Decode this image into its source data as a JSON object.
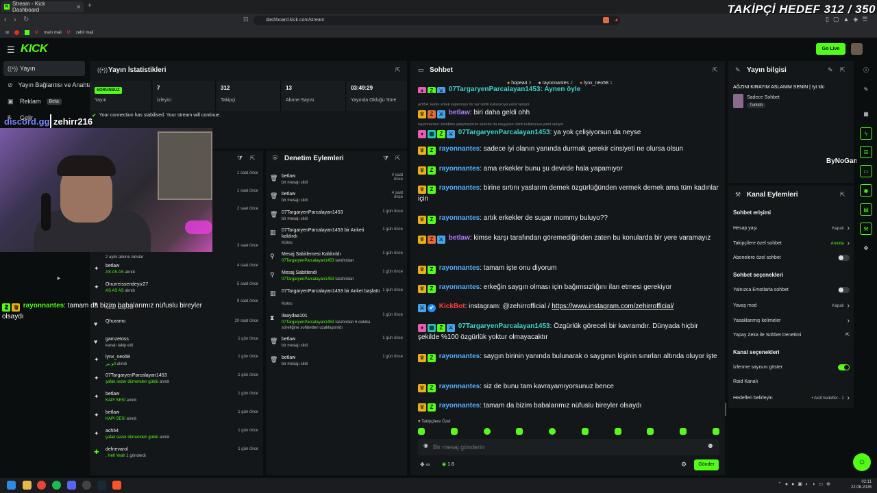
{
  "overlay": {
    "goal": "TAKİPÇİ HEDEF 312 / 350",
    "discord": "discord.gg",
    "streamer": "zehirr216",
    "watermark": "ByNoGame"
  },
  "browser": {
    "tab_title": "Stream - Kick Dashboard",
    "url": "dashboard.kick.com/stream",
    "bookmarks": [
      "main mail",
      "zehir mail"
    ]
  },
  "header": {
    "go_live": "Go Live"
  },
  "sidebar": {
    "items": [
      {
        "label": "Yayın",
        "icon": "broadcast-icon"
      },
      {
        "label": "Yayın Bağlantısı ve Anahtarı",
        "icon": "link-icon"
      },
      {
        "label": "Reklam",
        "icon": "ad-icon",
        "badge": "Beta"
      },
      {
        "label": "Gelir",
        "icon": "money-icon"
      }
    ]
  },
  "stats": {
    "title": "Yayın İstatistikleri",
    "status_badge": "SORUNSUZ",
    "items": [
      {
        "value": "",
        "label": "Yayın"
      },
      {
        "value": "7",
        "label": "İzleyici"
      },
      {
        "value": "312",
        "label": "Takipçi"
      },
      {
        "value": "13",
        "label": "Abone Sayısı"
      },
      {
        "value": "03:49:29",
        "label": "Yayında Olduğu Süre"
      }
    ],
    "notice": "Your connection has stabilised. Your stream will continue."
  },
  "activity": {
    "items": [
      {
        "name": "",
        "sub": "",
        "time": "1 saat önce"
      },
      {
        "name": "",
        "sub": "",
        "time": "1 saat önce"
      },
      {
        "name": "",
        "sub": "",
        "time": "2 saat önce"
      },
      {
        "name": "",
        "sub": "",
        "time": "3 saat önce"
      },
      {
        "name": "",
        "sub": "2 aylık abone oldular",
        "time": ""
      },
      {
        "name": "betlaw",
        "sub": "AS AS AS",
        "sub2": "alındı",
        "time": "4 saat önce"
      },
      {
        "name": "Onurreissendeyiz27",
        "sub": "AS AS AS",
        "sub2": "alındı",
        "time": "5 saat önce"
      },
      {
        "name": "",
        "sub": "kanalı takip etti",
        "time": "9 saat önce"
      },
      {
        "name": "Qhuramo",
        "sub": "",
        "time": "20 saat önce"
      },
      {
        "name": "gamzetoss",
        "sub": "kanalı takip etti",
        "time": "1 gün önce"
      },
      {
        "name": "lynx_neo58",
        "sub": "الو بير",
        "sub2": "alındı",
        "time": "1 gün önce"
      },
      {
        "name": "07TargaryenParcalayan1453",
        "sub": "şafak sezer dümenden güldü",
        "sub2": "alındı",
        "time": "1 gün önce"
      },
      {
        "name": "betlaw",
        "sub": "KAPI SESİ",
        "sub2": "alındı",
        "time": "1 gün önce"
      },
      {
        "name": "betlaw",
        "sub": "KAPI SESİ",
        "sub2": "alındı",
        "time": "1 gün önce"
      },
      {
        "name": "ach54",
        "sub": "şafak sezer dümenden güldü",
        "sub2": "alındı",
        "time": "1 gün önce"
      },
      {
        "name": "defnevarol",
        "sub": ", Hell Yeah",
        "sub2": "1",
        "sub3": "gönderdi",
        "time": "1 gün önce"
      }
    ]
  },
  "overlay_chat": {
    "user": "rayonnantes",
    "text": ": tamam da bizim babalarımız nüfuslu bireyler olsaydı"
  },
  "moderation": {
    "title": "Denetim Eylemleri",
    "items": [
      {
        "icon": "trash-icon",
        "name": "betlaw",
        "sub": "bir mesajı sildi",
        "time": "4 saat önce"
      },
      {
        "icon": "trash-icon",
        "name": "betlaw",
        "sub": "bir mesajı sildi",
        "time": "4 saat önce"
      },
      {
        "icon": "trash-icon",
        "name": "07TargaryenParcalayan1453",
        "sub": "bir mesajı sildi",
        "time": "1 gün önce"
      },
      {
        "icon": "poll-icon",
        "name": "07TargaryenParcalayan1453 bir Anketi kaldırdı",
        "sub": "Kokru",
        "time": "1 gün önce"
      },
      {
        "icon": "pin-icon",
        "name": "Mesaj Sabitlemesi Kaldırıldı",
        "sub": "07TargaryenParcalayan1453 tarafından",
        "time": "1 gün önce"
      },
      {
        "icon": "pin-icon",
        "name": "Mesaj Sabitlendi",
        "sub": "07TargaryenParcalayan1453 tarafından",
        "time": "1 gün önce"
      },
      {
        "icon": "poll-icon",
        "name": "07TargaryenParcalayan1453 bir Anket başlattı",
        "sub": "Kokru",
        "time": "1 gün önce"
      },
      {
        "icon": "timeout-icon",
        "name": "ilaaydaa101",
        "sub": "07TargaryenParcalayan1453 tarafından 5 dakika süreliğine sohbetten uzaklaştırıldı",
        "time": "1 gün önce"
      },
      {
        "icon": "trash-icon",
        "name": "betlaw",
        "sub": "bir mesajı sildi",
        "time": "1 gün önce"
      },
      {
        "icon": "trash-icon",
        "name": "betlaw",
        "sub": "bir mesajı sildi",
        "time": "1 gün önce"
      }
    ]
  },
  "chat": {
    "title": "Sohbet",
    "top_users": [
      {
        "name": "hopea4",
        "count": "3"
      },
      {
        "name": "rayonnantes",
        "count": "2"
      },
      {
        "name": "lynx_neo58",
        "count": "1"
      }
    ],
    "partial_top": "07TargaryenParcalayan1453: Aynen öyle",
    "reply1": "ach54: kadın erkek kapısması mı var isimli kullanıcıya yanıt veriyor",
    "reply2": "rayonnantes: kendime çalışmıyorum aslında da neyyysse isimli kullanıcıya yanıt veriyor",
    "messages": [
      {
        "user": "betlaw",
        "text": ": biri daha geldi ohh"
      },
      {
        "user": "07TargaryenParcalayan1453",
        "text": ": ya yok çelişiyorsun da neyse"
      },
      {
        "user": "rayonnantes",
        "text": ": sadece iyi olanın yanında durmak gerekir cinsiyeti ne olursa olsun"
      },
      {
        "user": "rayonnantes",
        "text": ": ama erkekler bunu şu devirde hala yapamıyor"
      },
      {
        "user": "rayonnantes",
        "text": ": birine sırtını yaslarım demek özgürlüğünden vermek demek ama tüm kadınlar için"
      },
      {
        "user": "rayonnantes",
        "text": ": artık erkekler de sugar mommy buluyo??"
      },
      {
        "user": "betlaw",
        "text": ": kimse karşı tarafından göremediğinden zaten bu konularda bir yere varamayız"
      },
      {
        "user": "rayonnantes",
        "text": ": tamam işte onu diyorum"
      },
      {
        "user": "rayonnantes",
        "text": ": erkeğin saygın olması için bağımsızlığını ilan etmesi gerekiyor"
      },
      {
        "user": "KickBot",
        "text": ": instagram: @zehirrofficial / ",
        "link": "https://www.instagram.com/zehirrofficial/"
      },
      {
        "user": "07TargaryenParcalayan1453",
        "text": ": Özgürlük göreceli bir kavramdır. Dünyada hiçbir şekilde %100 özgürlük yoktur olmayacaktır"
      },
      {
        "user": "rayonnantes",
        "text": ": saygın birinin yanında bulunarak o saygının kişinin sınırları altında oluyor işte"
      },
      {
        "user": "rayonnantes",
        "text": ": siz de bunu tam kavrayamıyorsunuz bence"
      },
      {
        "user": "rayonnantes",
        "text": ": tamam da bizim babalarımız nüfuslu bireyler olsaydı"
      }
    ],
    "followers_only": "Takipçilere Özel",
    "input_placeholder": "Bir mesaj gönderin",
    "viewer_count": "1 8",
    "send_label": "Gönder"
  },
  "stream_info": {
    "title": "Yayın bilgisi",
    "stream_title": "AĞZINI KIRAYIM ASLANIM SENİN | !yt !dc",
    "category": "Sadece Sohbet",
    "tag": "Turkish"
  },
  "channel_actions": {
    "title": "Kanal Eylemleri",
    "sections": [
      {
        "heading": "Sohbet erişimi",
        "rows": [
          {
            "label": "Hesap yaşı",
            "value": "Kapalı",
            "type": "chevron"
          },
          {
            "label": "Takipçilere özel sohbet",
            "value": "Anında",
            "type": "chevron",
            "accent": true
          },
          {
            "label": "Abonelere özel sohbet",
            "value": "",
            "type": "toggle-off"
          }
        ]
      },
      {
        "heading": "Sohbet seçenekleri",
        "rows": [
          {
            "label": "Yalnızca Emotlarla sohbet",
            "value": "",
            "type": "toggle-off"
          },
          {
            "label": "Yavaş mod",
            "value": "Kapalı",
            "type": "chevron"
          },
          {
            "label": "Yasaklanmış kelimeler",
            "value": "",
            "type": "chevron"
          },
          {
            "label": "Yapay Zeka ile Sohbet Denetimi",
            "value": "",
            "type": "external"
          }
        ]
      },
      {
        "heading": "Kanal seçenekleri",
        "rows": [
          {
            "label": "İzlenme sayısını göster",
            "value": "",
            "type": "toggle-on"
          },
          {
            "label": "Raid Kanalı",
            "value": "",
            "type": "none"
          },
          {
            "label": "Hedefleri belirleyin",
            "value": "• Aktif hedefler - 1",
            "type": "chevron"
          }
        ]
      }
    ]
  },
  "taskbar": {
    "time": "02:11",
    "date": "22.08.2026"
  },
  "colors": {
    "accent": "#53fc18",
    "bg": "#0b0e0f",
    "panel": "#141719"
  }
}
